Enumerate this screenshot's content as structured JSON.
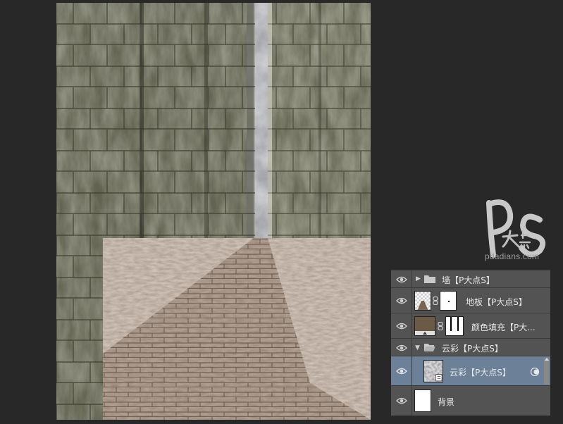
{
  "watermark": {
    "url": "pdadians.com"
  },
  "layers": [
    {
      "name": "墙【P大点S】",
      "type": "group",
      "expanded": false,
      "visible": true
    },
    {
      "name": "地板【P大点S】",
      "type": "layer-mask",
      "visible": true
    },
    {
      "name": "颜色填充【P大...",
      "type": "fill",
      "visible": true
    },
    {
      "name": "云彩【P大点S】",
      "type": "group",
      "expanded": true,
      "visible": true
    },
    {
      "name": "云彩【P大点S】",
      "type": "smart-object",
      "visible": true,
      "selected": true
    },
    {
      "name": "背景",
      "type": "background",
      "visible": true
    }
  ],
  "colors": {
    "panel": "#535353",
    "selected": "#6c8198",
    "fill_color": "#6b5a46"
  }
}
